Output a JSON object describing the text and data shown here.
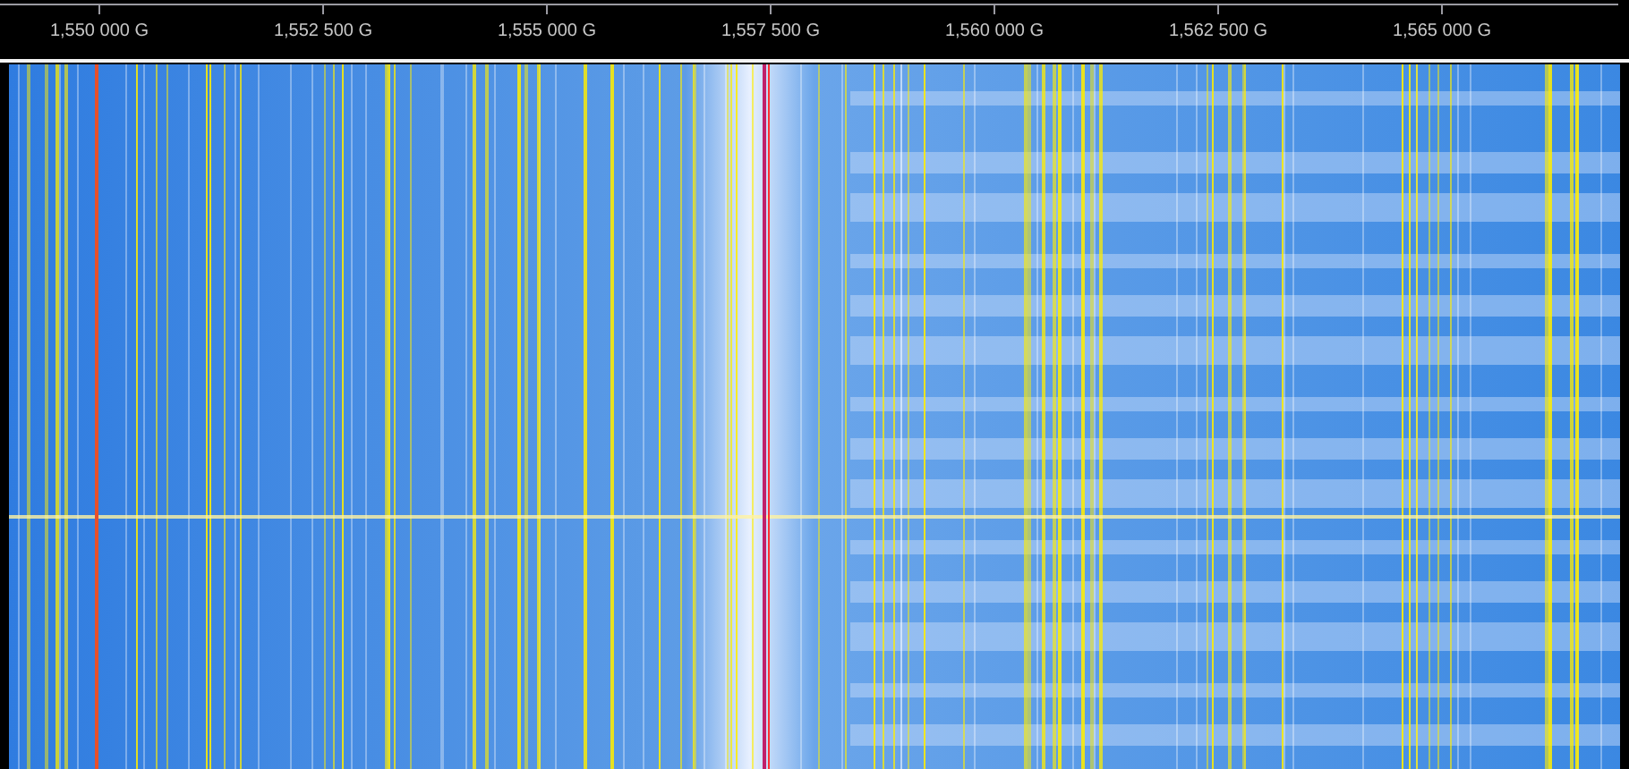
{
  "frequency_axis": {
    "ticks": [
      {
        "label": "1,550 000 G"
      },
      {
        "label": "1,552 500 G"
      },
      {
        "label": "1,555 000 G"
      },
      {
        "label": "1,557 500 G"
      },
      {
        "label": "1,560 000 G"
      },
      {
        "label": "1,562 500 G"
      },
      {
        "label": "1,565 000 G"
      }
    ]
  }
}
